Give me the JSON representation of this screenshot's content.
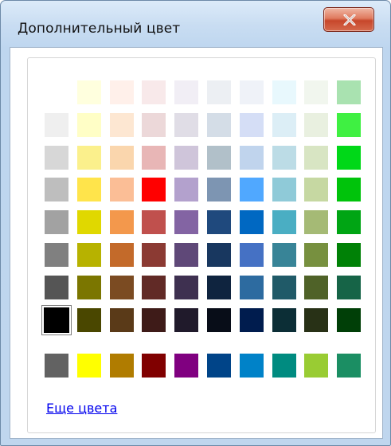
{
  "window": {
    "title": "Дополнительный цвет",
    "close_label": "X"
  },
  "palette": {
    "grid": [
      [
        "",
        "#ffffde",
        "#fff0ea",
        "#f8e9ea",
        "#f1eef5",
        "#eceff3",
        "#eff2f8",
        "#e8f8fd",
        "#f1f6ee",
        "#a9e2b0"
      ],
      [
        "#efefef",
        "#fffec6",
        "#fde7d2",
        "#ecd8d9",
        "#e0dde6",
        "#d4dde7",
        "#d5def6",
        "#dceef6",
        "#e9f0e0",
        "#3ff042"
      ],
      [
        "#d7d7d7",
        "#fbf08c",
        "#fad6ad",
        "#e8b6b6",
        "#cfc5da",
        "#b1c0c9",
        "#c0d4ed",
        "#bcdce6",
        "#d8e5c3",
        "#00d818"
      ],
      [
        "#bebebe",
        "#ffe44b",
        "#fbbe96",
        "#ff0000",
        "#b3a1cd",
        "#7d95b2",
        "#50a8ff",
        "#8fcad8",
        "#c6d8a2",
        "#00c30b"
      ],
      [
        "#a2a2a2",
        "#e0d800",
        "#f3984c",
        "#c0504d",
        "#8364a3",
        "#1f497d",
        "#0068c2",
        "#4aaec3",
        "#a5ba75",
        "#00a514"
      ],
      [
        "#808080",
        "#b7b200",
        "#c36a2a",
        "#8b3a33",
        "#5f4878",
        "#18375f",
        "#4571c4",
        "#388497",
        "#77903f",
        "#008106"
      ],
      [
        "#555555",
        "#7b7600",
        "#7b4b22",
        "#612a26",
        "#3e3050",
        "#0f243f",
        "#2d6ba0",
        "#205a68",
        "#4f6228",
        "#166447"
      ],
      [
        "#000000",
        "#4a4700",
        "#5a3a18",
        "#3e1b18",
        "#201a2b",
        "#080d18",
        "#001c4e",
        "#0c2e36",
        "#283116",
        "#003f07"
      ]
    ],
    "selected_index": 70,
    "standard": [
      "#626262",
      "#ffff00",
      "#b07c00",
      "#800000",
      "#800080",
      "#004488",
      "#0082c8",
      "#008b80",
      "#99cc33",
      "#1b8e63"
    ]
  },
  "more_colors_label": "Еще цвета"
}
